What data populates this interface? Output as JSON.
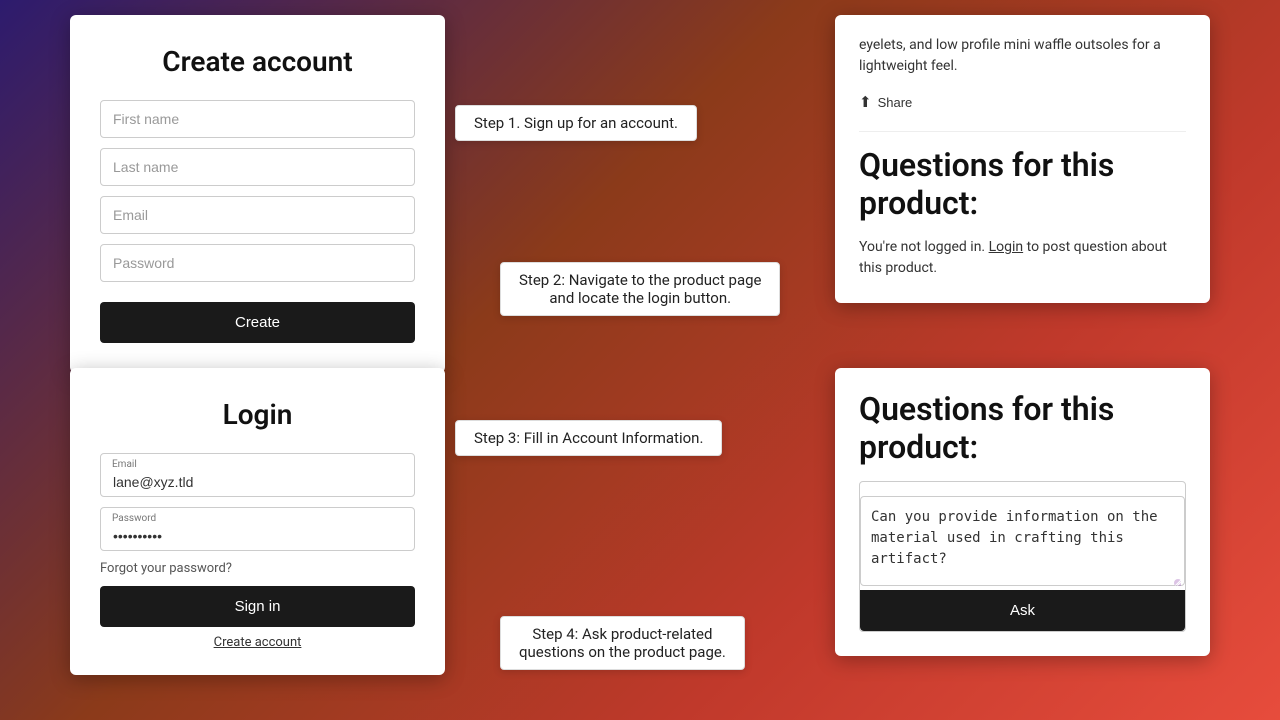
{
  "background": {
    "colors": [
      "#2d1b6e",
      "#8b3a1a",
      "#c0392b",
      "#e74c3c"
    ]
  },
  "createAccount": {
    "title": "Create account",
    "fields": {
      "firstName": {
        "placeholder": "First name"
      },
      "lastName": {
        "placeholder": "Last name"
      },
      "email": {
        "placeholder": "Email"
      },
      "password": {
        "placeholder": "Password"
      }
    },
    "createButton": "Create"
  },
  "login": {
    "title": "Login",
    "emailLabel": "Email",
    "emailValue": "lane@xyz.tld",
    "passwordLabel": "Password",
    "passwordValue": "••••••••••",
    "forgotLink": "Forgot your password?",
    "signInButton": "Sign in",
    "createAccountLink": "Create account"
  },
  "steps": {
    "step1": "Step 1. Sign up for an account.",
    "step2": "Step 2: Navigate to the product page\nand locate the login button.",
    "step3": "Step 3: Fill in Account Information.",
    "step4": "Step 4: Ask product-related\nquestions on the product page."
  },
  "productTop": {
    "description": "eyelets, and low profile mini waffle outsoles for a lightweight feel.",
    "shareLabel": "Share",
    "shareIcon": "share-icon",
    "divider": true,
    "questionsTitle": "Questions for this product:",
    "notLoggedText": "You're not logged in.",
    "loginLinkText": "Login",
    "postText": "to post question about this product."
  },
  "productBottom": {
    "questionsTitle": "Questions for this product:",
    "questionPlaceholder": "Can you provide information on the material used in crafting this artifact?",
    "askButton": "Ask",
    "resizeIcon": "resize-icon"
  }
}
